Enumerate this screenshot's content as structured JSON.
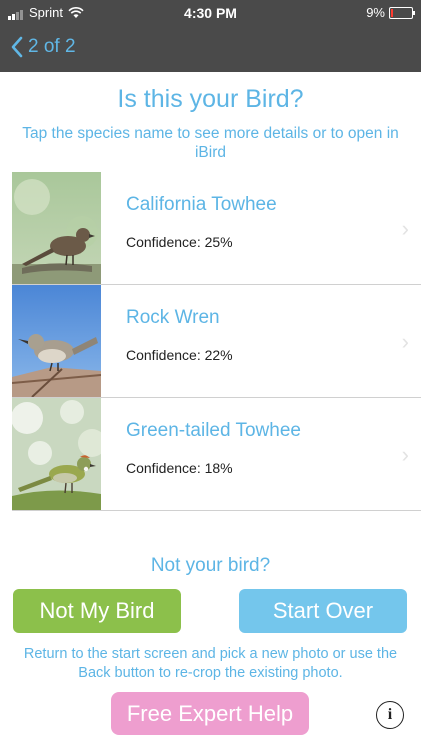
{
  "status": {
    "carrier": "Sprint",
    "time": "4:30 PM",
    "battery": "9%"
  },
  "nav": {
    "back_label": "2 of 2"
  },
  "header": {
    "title": "Is this your Bird?",
    "subtitle": "Tap the species name to see more details or to open in iBird"
  },
  "results": [
    {
      "name": "California Towhee",
      "confidence": "Confidence: 25%"
    },
    {
      "name": "Rock Wren",
      "confidence": "Confidence: 22%"
    },
    {
      "name": "Green-tailed Towhee",
      "confidence": "Confidence: 18%"
    }
  ],
  "footer": {
    "prompt": "Not your bird?",
    "not_my_bird_label": "Not My Bird",
    "start_over_label": "Start Over",
    "help_text": "Return to the start screen and pick a new photo or use the Back button to re-crop the existing photo.",
    "expert_label": "Free Expert Help",
    "info_glyph": "i"
  },
  "colors": {
    "accent": "#5db5e5",
    "bar": "#4a4a4a",
    "green_button": "#8cc04b",
    "blue_button": "#74c6ec",
    "pink_button": "#ee9ecf"
  },
  "icons": [
    "signal-icon",
    "wifi-icon",
    "battery-icon",
    "back-chevron-icon",
    "chevron-right-icon",
    "info-icon"
  ]
}
